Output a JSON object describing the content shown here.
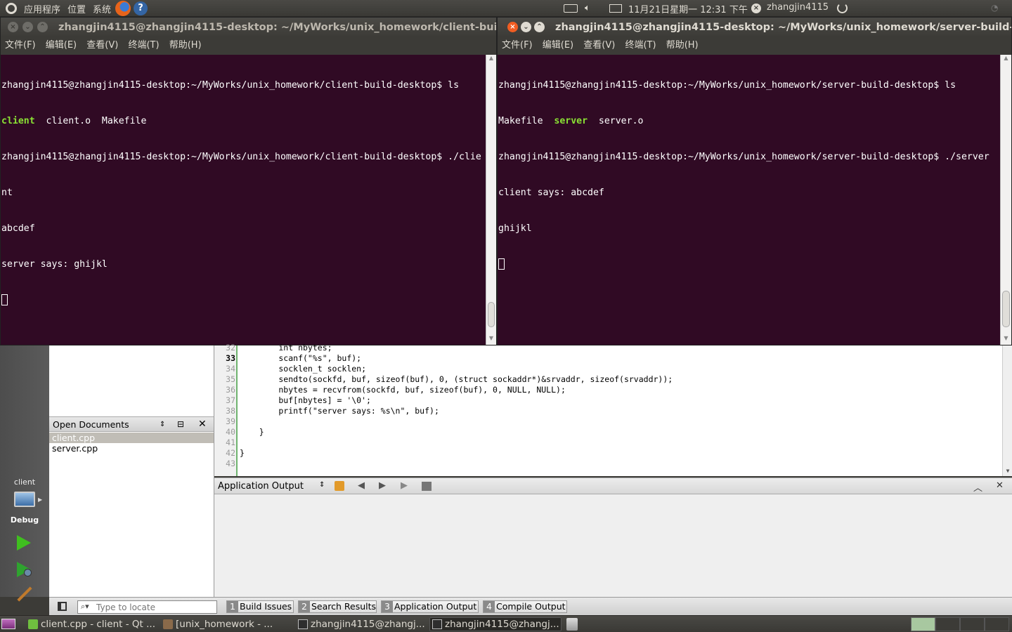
{
  "top_panel": {
    "menu_apps": "应用程序",
    "menu_places": "位置",
    "menu_system": "系统",
    "clock": "11月21日星期一 12:31 下午",
    "username": "zhangjin4115"
  },
  "terminal_left": {
    "title": "zhangjin4115@zhangjin4115-desktop: ~/MyWorks/unix_homework/client-build-de",
    "menu": [
      "文件(F)",
      "编辑(E)",
      "查看(V)",
      "终端(T)",
      "帮助(H)"
    ],
    "lines": [
      "zhangjin4115@zhangjin4115-desktop:~/MyWorks/unix_homework/client-build-desktop$ ls",
      "client  client.o  Makefile",
      "zhangjin4115@zhangjin4115-desktop:~/MyWorks/unix_homework/client-build-desktop$ ./clie",
      "nt",
      "abcdef",
      "server says: ghijkl"
    ],
    "ls_exec": "client",
    "ls_rest": "  client.o  Makefile"
  },
  "terminal_right": {
    "title": "zhangjin4115@zhangjin4115-desktop: ~/MyWorks/unix_homework/server-build-desk",
    "menu": [
      "文件(F)",
      "编辑(E)",
      "查看(V)",
      "终端(T)",
      "帮助(H)"
    ],
    "lines": [
      "zhangjin4115@zhangjin4115-desktop:~/MyWorks/unix_homework/server-build-desktop$ ls",
      "Makefile  server  server.o",
      "zhangjin4115@zhangjin4115-desktop:~/MyWorks/unix_homework/server-build-desktop$ ./server",
      "client says: abcdef",
      "ghijkl"
    ],
    "ls_pre": "Makefile  ",
    "ls_exec": "server",
    "ls_post": "  server.o"
  },
  "qt": {
    "target_project": "client",
    "target_mode": "Debug",
    "open_documents_label": "Open Documents",
    "documents": [
      "client.cpp",
      "server.cpp"
    ],
    "code_lines": [
      {
        "n": "32",
        "t": "        int nbytes;"
      },
      {
        "n": "33",
        "t": "        scanf(\"%s\", buf);"
      },
      {
        "n": "34",
        "t": "        socklen_t socklen;"
      },
      {
        "n": "35",
        "t": "        sendto(sockfd, buf, sizeof(buf), 0, (struct sockaddr*)&srvaddr, sizeof(srvaddr));"
      },
      {
        "n": "36",
        "t": "        nbytes = recvfrom(sockfd, buf, sizeof(buf), 0, NULL, NULL);"
      },
      {
        "n": "37",
        "t": "        buf[nbytes] = '\\0';"
      },
      {
        "n": "38",
        "t": "        printf(\"server says: %s\\n\", buf);"
      },
      {
        "n": "39",
        "t": ""
      },
      {
        "n": "40",
        "t": "    }"
      },
      {
        "n": "41",
        "t": ""
      },
      {
        "n": "42",
        "t": "}"
      },
      {
        "n": "43",
        "t": ""
      }
    ],
    "output_pane_label": "Application Output",
    "locator_placeholder": "Type to locate",
    "status_tabs": [
      {
        "num": "1",
        "label": "Build Issues"
      },
      {
        "num": "2",
        "label": "Search Results"
      },
      {
        "num": "3",
        "label": "Application Output"
      },
      {
        "num": "4",
        "label": "Compile Output"
      }
    ]
  },
  "taskbar": {
    "items": [
      "client.cpp - client - Qt ...",
      "[unix_homework - ...",
      "zhangjin4115@zhangj...",
      "zhangjin4115@zhangj..."
    ]
  },
  "colors": {
    "terminal_bg": "#300a24",
    "panel_bg": "#3c3b37",
    "exec_green": "#8ae234",
    "close_orange": "#f15d22"
  }
}
